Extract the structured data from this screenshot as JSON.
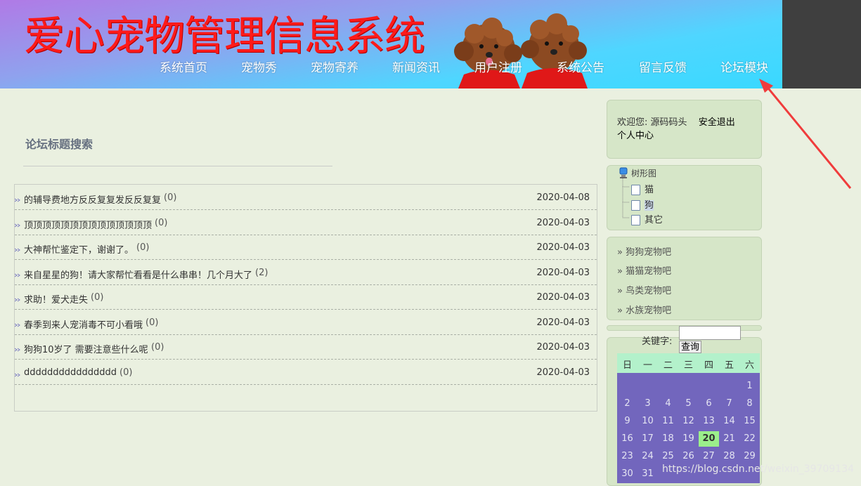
{
  "header": {
    "site_title": "爱心宠物管理信息系统",
    "nav": [
      "系统首页",
      "宠物秀",
      "宠物寄养",
      "新闻资讯",
      "用户注册",
      "系统公告",
      "留言反馈",
      "论坛模块"
    ]
  },
  "main": {
    "search_title": "论坛标题搜索",
    "topics": [
      {
        "title": "的辅导费地方反反复复发反反复复",
        "count": "(0)",
        "date": "2020-04-08"
      },
      {
        "title": "顶顶顶顶顶顶顶顶顶顶顶顶顶顶",
        "count": "(0)",
        "date": "2020-04-03"
      },
      {
        "title": "大神帮忙鉴定下，谢谢了。",
        "count": "(0)",
        "date": "2020-04-03"
      },
      {
        "title": "来自星星的狗！请大家帮忙看看是什么串串！几个月大了",
        "count": "(2)",
        "date": "2020-04-03"
      },
      {
        "title": "求助！爱犬走失",
        "count": "(0)",
        "date": "2020-04-03"
      },
      {
        "title": "春季到来人宠消毒不可小看哦",
        "count": "(0)",
        "date": "2020-04-03"
      },
      {
        "title": "狗狗10岁了 需要注意些什么呢",
        "count": "(0)",
        "date": "2020-04-03"
      },
      {
        "title": "dddddddddddddddd",
        "count": "(0)",
        "date": "2020-04-03"
      }
    ]
  },
  "sidebar": {
    "welcome_prefix": "欢迎您:",
    "username": "源码码头",
    "logout": "安全退出",
    "user_center": "个人中心",
    "tree_root": "树形图",
    "tree_items": [
      "猫",
      "狗",
      "其它"
    ],
    "links": [
      "» 狗狗宠物吧",
      "» 猫猫宠物吧",
      "» 鸟类宠物吧",
      "» 水族宠物吧"
    ],
    "keyword_label": "关键字:",
    "keyword_value": "",
    "query_button": "查询",
    "calendar": {
      "weekdays": [
        "日",
        "一",
        "二",
        "三",
        "四",
        "五",
        "六"
      ],
      "days": [
        "1",
        "2",
        "3",
        "4",
        "5",
        "6",
        "7",
        "8",
        "9",
        "10",
        "11",
        "12",
        "13",
        "14",
        "15",
        "16",
        "17",
        "18",
        "19",
        "20",
        "21",
        "22",
        "23",
        "24",
        "25",
        "26",
        "27",
        "28",
        "29",
        "30",
        "31"
      ],
      "first_weekday": 6,
      "today": "20"
    }
  },
  "watermark": "https://blog.csdn.net/weixin_39709134",
  "colors": {
    "title": "#ff1a1a",
    "sidebar_bg": "#d6e6c8",
    "calendar_bg": "#7266bd",
    "calendar_header": "#b3f1cb",
    "today": "#9bef8b",
    "page_bg": "#eaf0e0"
  }
}
